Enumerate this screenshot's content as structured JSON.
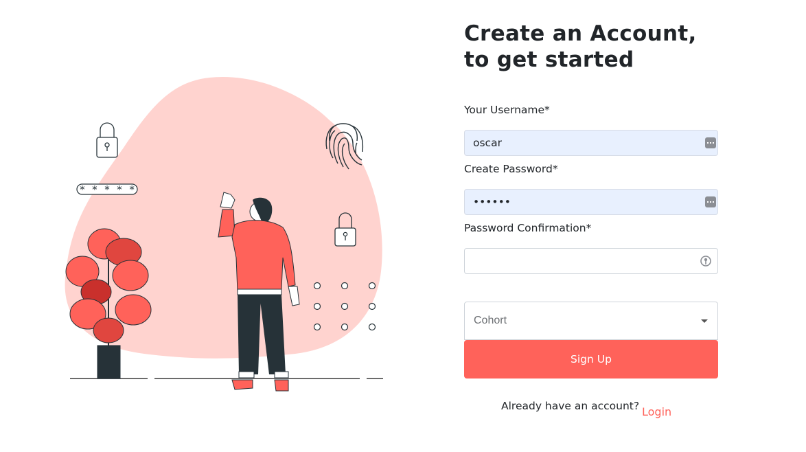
{
  "form": {
    "title": "Create an Account, to get started",
    "username": {
      "label": "Your Username*",
      "value": "oscar"
    },
    "password": {
      "label": "Create Password*",
      "value": "••••••"
    },
    "confirm": {
      "label": "Password Confirmation*",
      "value": ""
    },
    "cohort": {
      "placeholder": "Cohort"
    },
    "submit_label": "Sign Up",
    "already_text": "Already have an account?",
    "login_label": "Login"
  },
  "illustration": {
    "password_field_text": "* * * * *"
  },
  "colors": {
    "accent": "#ff625a",
    "autofill_bg": "#e8f0fe",
    "blob": "#ffd3cf",
    "text": "#212529"
  },
  "icons": [
    "password-manager-icon",
    "key-icon",
    "chevron-down-icon"
  ]
}
